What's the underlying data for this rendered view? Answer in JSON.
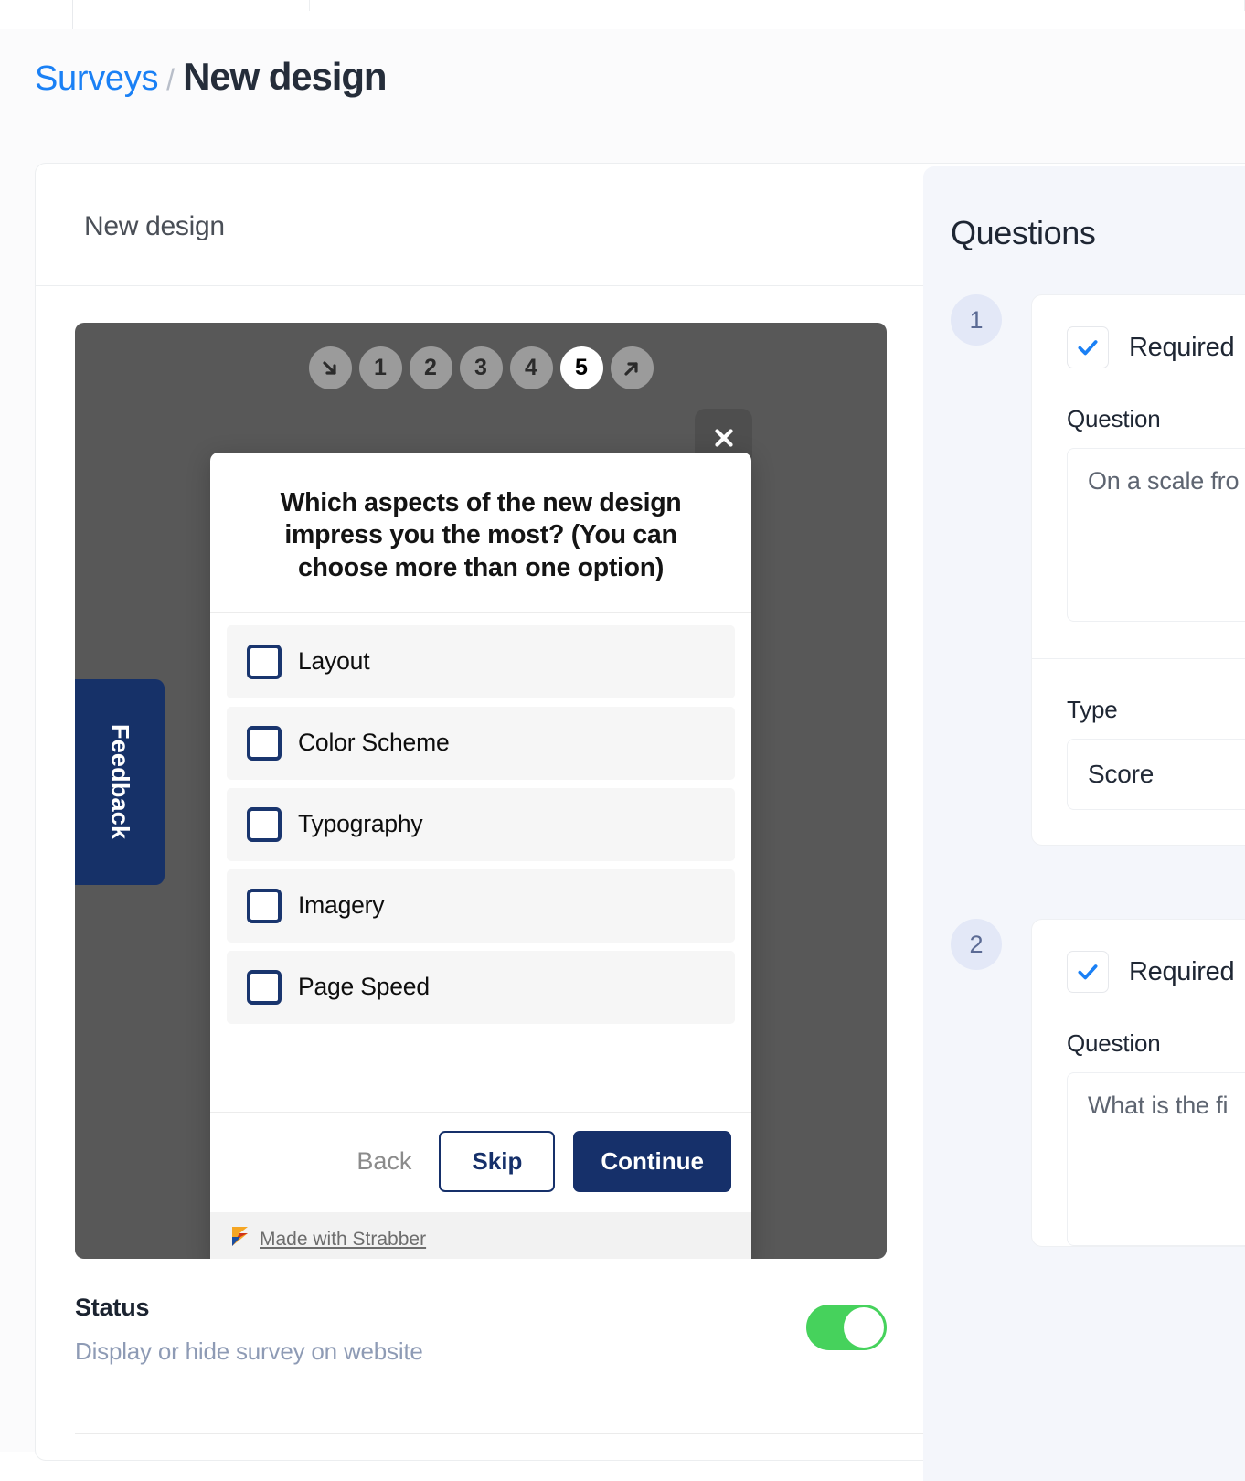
{
  "breadcrumb": {
    "parent": "Surveys",
    "separator": "/",
    "current": "New design"
  },
  "card": {
    "title": "New design"
  },
  "preview": {
    "stepnav": {
      "prev_icon": "arrow-down-right-icon",
      "next_icon": "arrow-up-right-icon",
      "steps": [
        "1",
        "2",
        "3",
        "4",
        "5"
      ],
      "active_step": "5"
    },
    "close_icon": "close-icon",
    "feedback_tab_label": "Feedback",
    "modal": {
      "question": "Which aspects of the new design impress you the most? (You can choose more than one option)",
      "options": [
        {
          "label": "Layout",
          "checked": false
        },
        {
          "label": "Color Scheme",
          "checked": false
        },
        {
          "label": "Typography",
          "checked": false
        },
        {
          "label": "Imagery",
          "checked": false
        },
        {
          "label": "Page Speed",
          "checked": false
        }
      ],
      "buttons": {
        "back": "Back",
        "skip": "Skip",
        "continue": "Continue"
      },
      "branding": {
        "text": "Made with Strabber",
        "logo_icon": "strabber-logo-icon"
      }
    }
  },
  "status": {
    "title": "Status",
    "subtitle": "Display or hide survey on website",
    "toggle_on": true,
    "toggle_color": "#46d25c"
  },
  "questions_panel": {
    "title": "Questions",
    "items": [
      {
        "number": "1",
        "required_label": "Required",
        "required_checked": true,
        "question_label": "Question",
        "question_value": "On a scale fro",
        "type_label": "Type",
        "type_value": "Score"
      },
      {
        "number": "2",
        "required_label": "Required",
        "required_checked": true,
        "question_label": "Question",
        "question_value": "What is the fi"
      }
    ]
  },
  "colors": {
    "accent_blue": "#1a80f5",
    "navy": "#16306a",
    "check_blue": "#1a80f5",
    "stage_backdrop": "#585858",
    "panel_bg": "#f4f6fb"
  }
}
